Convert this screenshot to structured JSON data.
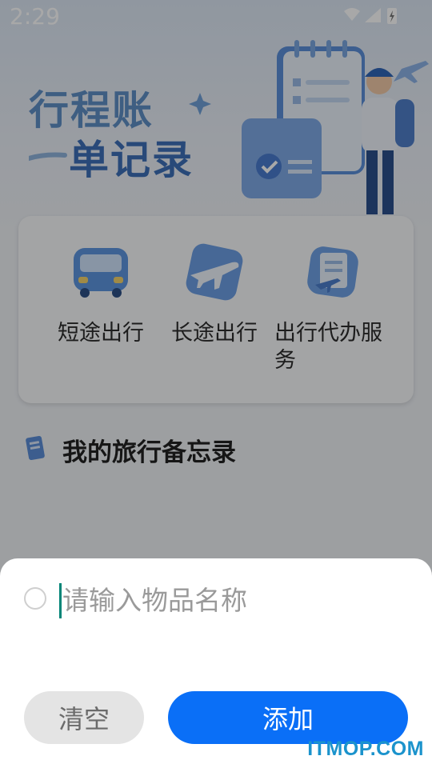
{
  "status_bar": {
    "time": "2:29",
    "icons": [
      "wifi-icon",
      "signal-icon",
      "battery-charging-icon"
    ]
  },
  "hero": {
    "title_line1": "行程账",
    "title_line2": "单记录"
  },
  "categories": [
    {
      "label": "短途出行",
      "icon": "bus-icon"
    },
    {
      "label": "长途出行",
      "icon": "airplane-icon"
    },
    {
      "label": "出行代办服务",
      "icon": "document-plane-icon"
    }
  ],
  "memo": {
    "title": "我的旅行备忘录",
    "icon": "notebook-icon"
  },
  "sheet": {
    "input_placeholder": "请输入物品名称",
    "input_value": "",
    "clear_label": "清空",
    "add_label": "添加"
  },
  "watermark": "ITMOP.COM",
  "colors": {
    "accent": "#0a6ff7",
    "cursor": "#008577",
    "watermark": "#1b93cc"
  }
}
